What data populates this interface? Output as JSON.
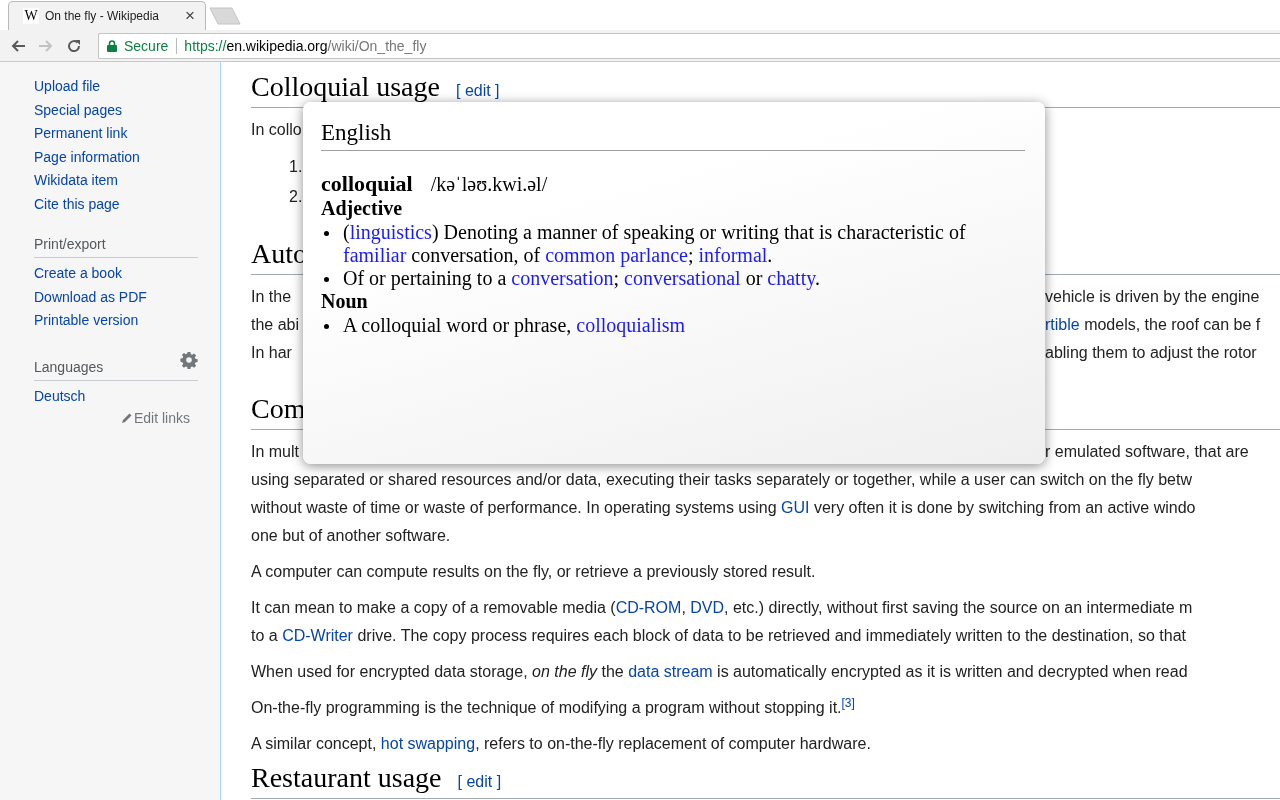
{
  "browser": {
    "tab": {
      "favicon": "W",
      "title": "On the fly - Wikipedia",
      "close": "×"
    },
    "nav": [
      {
        "kind": "back",
        "disabled": false
      },
      {
        "kind": "forward",
        "disabled": true
      },
      {
        "kind": "reload",
        "disabled": false
      }
    ],
    "address": {
      "security": "Secure",
      "scheme": "https://",
      "host": "en.wikipedia.org",
      "path": "/wiki/On_the_fly"
    }
  },
  "sidebar": {
    "sections": [
      {
        "items": [
          "Upload file",
          "Special pages",
          "Permanent link",
          "Page information",
          "Wikidata item",
          "Cite this page"
        ]
      },
      {
        "heading": "Print/export",
        "items": [
          "Create a book",
          "Download as PDF",
          "Printable version"
        ]
      },
      {
        "heading": "Languages",
        "settings": true,
        "items": [
          "Deutsch"
        ],
        "edit_links": "Edit links"
      }
    ]
  },
  "article": {
    "blocks": [
      {
        "kind": "heading",
        "text": "Colloquial usage",
        "edit": "[ edit ]"
      },
      {
        "kind": "fragment",
        "left": "In collo"
      },
      {
        "kind": "number",
        "text": "1."
      },
      {
        "kind": "number",
        "text": "2."
      },
      {
        "kind": "heading",
        "text": "Auto"
      },
      {
        "kind": "fragment",
        "left": "In the",
        "right": [
          {
            "kind": "text",
            "text": "vehicle is driven by the engine"
          }
        ]
      },
      {
        "kind": "fragment",
        "left": "the abi",
        "right": [
          {
            "kind": "link",
            "text": "rtible"
          },
          {
            "kind": "text",
            "text": " models, the roof can be f"
          }
        ]
      },
      {
        "kind": "fragment",
        "left": "In har",
        "right": [
          {
            "kind": "text",
            "text": "abling them to adjust the rotor"
          }
        ]
      },
      {
        "kind": "heading",
        "text": "Com"
      },
      {
        "kind": "fragment",
        "left": "In mult",
        "right": [
          {
            "kind": "text",
            "text": "r emulated software, that are"
          }
        ]
      },
      {
        "kind": "para",
        "lines": [
          [
            {
              "kind": "text",
              "text": "using separated or shared resources and/or data, executing their tasks separately or together, while a user can switch on the fly betw"
            }
          ],
          [
            {
              "kind": "text",
              "text": "without waste of time or waste of performance. In operating systems using "
            },
            {
              "kind": "link",
              "text": "GUI"
            },
            {
              "kind": "text",
              "text": " very often it is done by switching from an active windo"
            }
          ],
          [
            {
              "kind": "text",
              "text": "one but of another software."
            }
          ]
        ]
      },
      {
        "kind": "para",
        "lines": [
          [
            {
              "kind": "text",
              "text": "A computer can compute results on the fly, or retrieve a previously stored result."
            }
          ]
        ]
      },
      {
        "kind": "para",
        "lines": [
          [
            {
              "kind": "text",
              "text": "It can mean to make a copy of a removable media ("
            },
            {
              "kind": "link",
              "text": "CD-ROM"
            },
            {
              "kind": "text",
              "text": ", "
            },
            {
              "kind": "link",
              "text": "DVD"
            },
            {
              "kind": "text",
              "text": ", etc.) directly, without first saving the source on an intermediate m"
            }
          ],
          [
            {
              "kind": "text",
              "text": "to a "
            },
            {
              "kind": "link",
              "text": "CD-Writer"
            },
            {
              "kind": "text",
              "text": " drive. The copy process requires each block of data to be retrieved and immediately written to the destination, so that"
            }
          ]
        ]
      },
      {
        "kind": "para",
        "lines": [
          [
            {
              "kind": "text",
              "text": "When used for encrypted data storage, "
            },
            {
              "kind": "italic",
              "text": "on the fly"
            },
            {
              "kind": "text",
              "text": " the "
            },
            {
              "kind": "link",
              "text": "data stream"
            },
            {
              "kind": "text",
              "text": " is automatically encrypted as it is written and decrypted when read"
            }
          ]
        ]
      },
      {
        "kind": "para",
        "lines": [
          [
            {
              "kind": "text",
              "text": "On-the-fly programming is the technique of modifying a program without stopping it."
            },
            {
              "kind": "ref",
              "text": "[3]"
            }
          ]
        ]
      },
      {
        "kind": "para",
        "lines": [
          [
            {
              "kind": "text",
              "text": "A similar concept, "
            },
            {
              "kind": "link",
              "text": "hot swapping"
            },
            {
              "kind": "text",
              "text": ", refers to on-the-fly replacement of computer hardware."
            }
          ]
        ]
      },
      {
        "kind": "heading",
        "text": "Restaurant usage",
        "edit": "[ edit ]"
      }
    ]
  },
  "popup": {
    "language": "English",
    "word": "colloquial",
    "pronunciation": "/kəˈləʊ.kwi.əl/",
    "sections": [
      {
        "pos": "Adjective",
        "definitions": [
          [
            {
              "kind": "text",
              "text": "("
            },
            {
              "kind": "link",
              "text": "linguistics"
            },
            {
              "kind": "text",
              "text": ") Denoting a manner of speaking or writing that is characteristic of "
            },
            {
              "kind": "link",
              "text": "familiar"
            },
            {
              "kind": "text",
              "text": " conversation, of "
            },
            {
              "kind": "link",
              "text": "common parlance"
            },
            {
              "kind": "text",
              "text": "; "
            },
            {
              "kind": "link",
              "text": "informal"
            },
            {
              "kind": "text",
              "text": "."
            }
          ],
          [
            {
              "kind": "text",
              "text": "Of or pertaining to a "
            },
            {
              "kind": "link",
              "text": "conversation"
            },
            {
              "kind": "text",
              "text": "; "
            },
            {
              "kind": "link",
              "text": "conversational"
            },
            {
              "kind": "text",
              "text": " or "
            },
            {
              "kind": "link",
              "text": "chatty"
            },
            {
              "kind": "text",
              "text": "."
            }
          ]
        ]
      },
      {
        "pos": "Noun",
        "definitions": [
          [
            {
              "kind": "text",
              "text": "A colloquial word or phrase, "
            },
            {
              "kind": "link",
              "text": "colloquialism"
            }
          ]
        ]
      }
    ]
  }
}
